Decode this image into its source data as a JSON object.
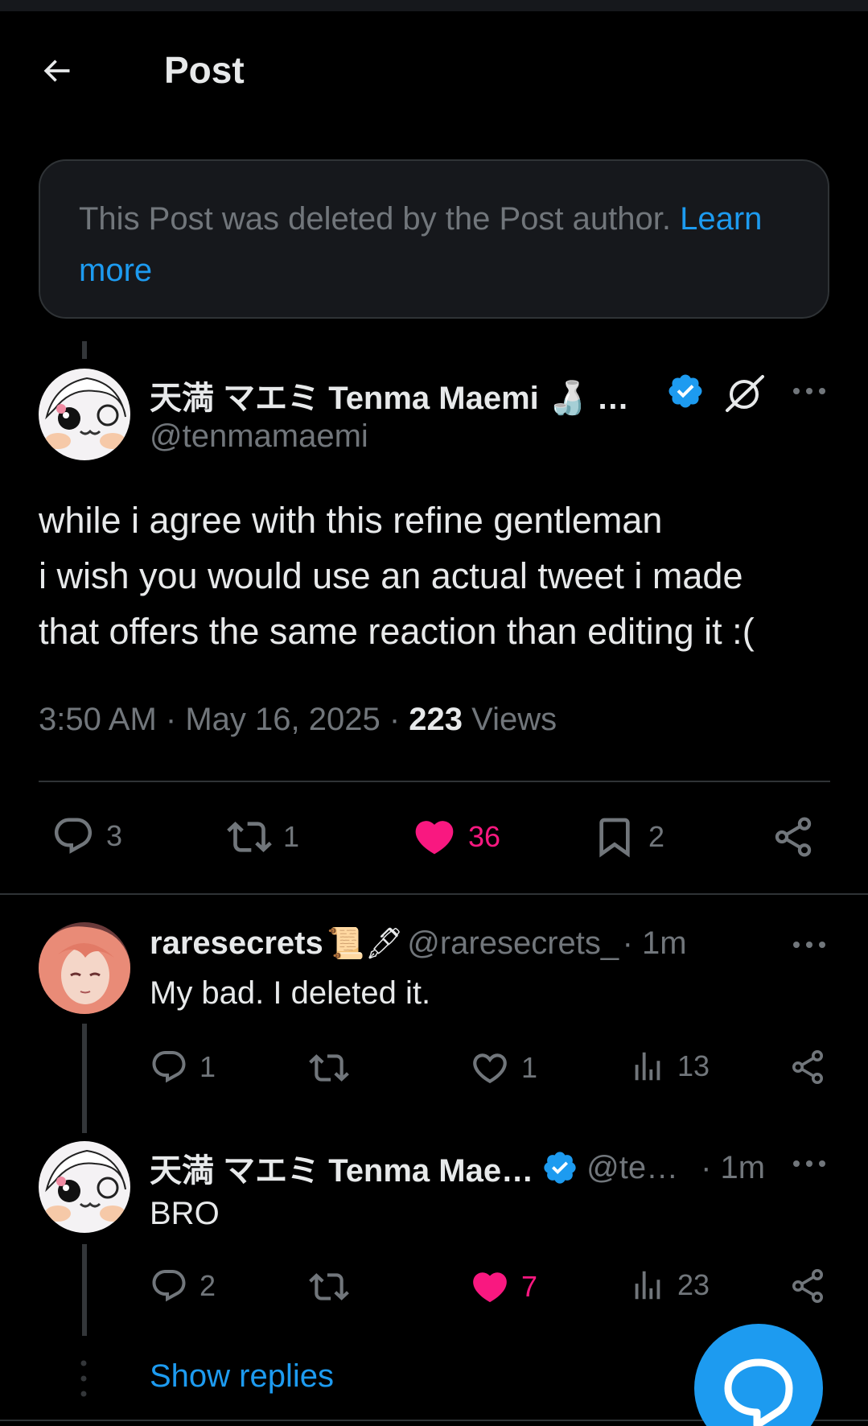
{
  "header": {
    "title": "Post"
  },
  "deleted_notice": {
    "text": "This Post was deleted by the Post author.",
    "link": "Learn more"
  },
  "main_post": {
    "author_name": "天満 マエミ Tenma Maemi",
    "author_emoji": "🍶",
    "ellipsis": "…",
    "handle": "@tenmamaemi",
    "lines": [
      "while i agree with this refine gentleman",
      "i wish you would use an actual tweet i made",
      "that offers the same reaction than editing it :("
    ],
    "time": "3:50 AM",
    "date": "May 16, 2025",
    "views_count": "223",
    "views_label": "Views",
    "replies": "3",
    "reposts": "1",
    "likes": "36",
    "bookmarks": "2"
  },
  "replies": [
    {
      "name": "raresecrets",
      "emojis": "📜🖋",
      "handle": "@raresecrets_",
      "time": "· 1m",
      "text": "My bad. I deleted it.",
      "replies": "1",
      "reposts": "",
      "likes": "1",
      "views": "13",
      "liked": false
    },
    {
      "name": "天満 マエミ Tenma Mae…",
      "emojis": "",
      "handle": "@te…",
      "time": "· 1m",
      "text": "BRO",
      "replies": "2",
      "reposts": "",
      "likes": "7",
      "views": "23",
      "liked": true
    }
  ],
  "show_replies": "Show replies",
  "colors": {
    "accent": "#1d9bf0",
    "like": "#f91880",
    "muted": "#71767b",
    "background": "#000000"
  }
}
